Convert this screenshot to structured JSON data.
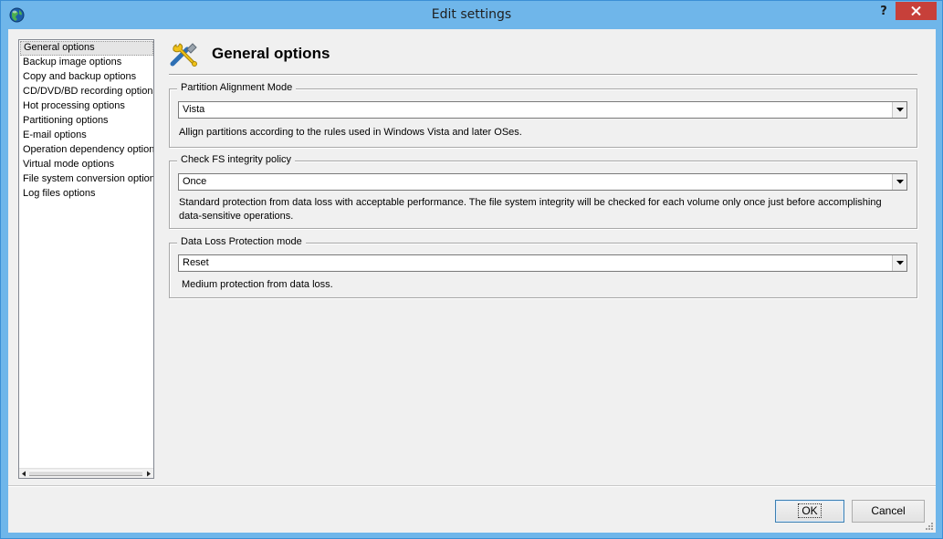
{
  "window": {
    "title": "Edit settings",
    "help_label": "?",
    "icons": {
      "app": "globe-icon",
      "close": "close-icon"
    },
    "colors": {
      "titlebar": "#6fb6ea",
      "close_button": "#c7403a"
    }
  },
  "nav": {
    "items": [
      {
        "label": "General options",
        "selected": true
      },
      {
        "label": "Backup image options"
      },
      {
        "label": "Copy and backup options"
      },
      {
        "label": "CD/DVD/BD recording options"
      },
      {
        "label": "Hot processing options"
      },
      {
        "label": "Partitioning options"
      },
      {
        "label": "E-mail options"
      },
      {
        "label": "Operation dependency options"
      },
      {
        "label": "Virtual mode options"
      },
      {
        "label": "File system conversion options"
      },
      {
        "label": "Log files options"
      }
    ]
  },
  "header": {
    "title": "General options",
    "icon": "tools-icon"
  },
  "groups": [
    {
      "legend": "Partition Alignment Mode",
      "value": "Vista",
      "description": "Allign partitions according to the rules used in Windows Vista and later OSes."
    },
    {
      "legend": "Check FS integrity policy",
      "value": "Once",
      "description": "Standard protection from data loss with acceptable performance. The file system integrity will be checked for each volume only once just before accomplishing data-sensitive operations."
    },
    {
      "legend": "Data Loss Protection mode",
      "value": "Reset",
      "description": "Medium protection from data loss."
    }
  ],
  "buttons": {
    "ok": "OK",
    "cancel": "Cancel"
  }
}
